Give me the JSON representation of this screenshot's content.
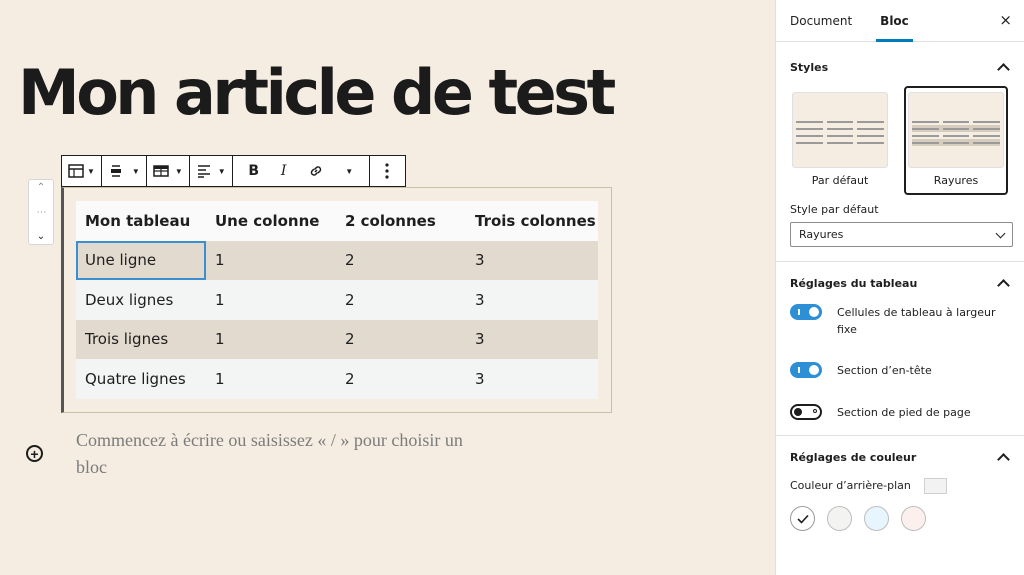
{
  "editor": {
    "title": "Mon article de test",
    "placeholder": "Commencez à écrire ou saisissez « / » pour choisir un bloc"
  },
  "toolbar": {
    "icons": [
      "table-icon",
      "align-center-icon",
      "edit-table-icon",
      "text-align-icon",
      "bold-icon",
      "italic-icon",
      "link-icon",
      "more-rich-text-icon",
      "more-options-icon"
    ],
    "bold_label": "B",
    "italic_label": "I"
  },
  "table": {
    "headers": [
      "Mon tableau",
      "Une colonne",
      "2 colonnes",
      "Trois colonnes"
    ],
    "rows": [
      [
        "Une ligne",
        "1",
        "2",
        "3"
      ],
      [
        "Deux lignes",
        "1",
        "2",
        "3"
      ],
      [
        "Trois lignes",
        "1",
        "2",
        "3"
      ],
      [
        "Quatre lignes",
        "1",
        "2",
        "3"
      ]
    ],
    "selected_cell": "Une ligne"
  },
  "sidebar": {
    "tabs": [
      "Document",
      "Bloc"
    ],
    "active_tab": "Bloc",
    "close_icon": "×",
    "styles": {
      "title": "Styles",
      "options": [
        "Par défaut",
        "Rayures"
      ],
      "active": "Rayures",
      "default_style_label": "Style par défaut",
      "default_style_value": "Rayures"
    },
    "table_settings": {
      "title": "Réglages du tableau",
      "toggles": [
        {
          "label": "Cellules de tableau à largeur fixe",
          "on": true
        },
        {
          "label": "Section d’en-tête",
          "on": true
        },
        {
          "label": "Section de pied de page",
          "on": false
        }
      ]
    },
    "color_settings": {
      "title": "Réglages de couleur",
      "background_label": "Couleur d’arrière-plan",
      "swatches": [
        "#ffffff",
        "#f3f4f1",
        "#e7f5fe",
        "#fcf0ef"
      ]
    }
  },
  "colors": {
    "editor_bg": "#f5ede1",
    "stripe": "#e2dace",
    "accent": "#007cba",
    "toggle_on": "#2d8fd5"
  }
}
